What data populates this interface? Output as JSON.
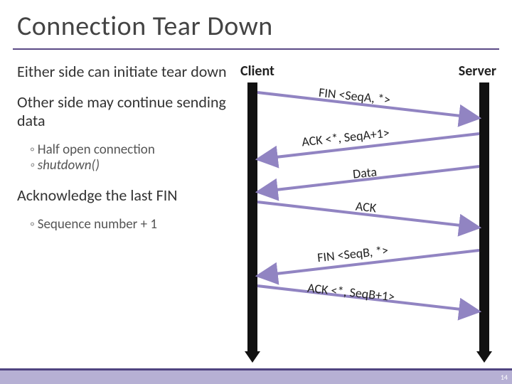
{
  "title": "Connection Tear Down",
  "bullets": {
    "p1": "Either side can initiate tear down",
    "p2": "Other side may continue sending data",
    "p2a": "Half open connection",
    "p2b": "shutdown()",
    "p3": "Acknowledge the last FIN",
    "p3a": "Sequence number + 1"
  },
  "labels": {
    "client": "Client",
    "server": "Server"
  },
  "messages": {
    "m1": "FIN <SeqA, *>",
    "m2": "ACK <*, SeqA+1>",
    "m3": "Data",
    "m4": "ACK",
    "m5": "FIN <SeqB, *>",
    "m6": "ACK <*, SeqB+1>"
  },
  "page": "14",
  "colors": {
    "accent": "#9184c2",
    "rule": "#5b4a86"
  }
}
